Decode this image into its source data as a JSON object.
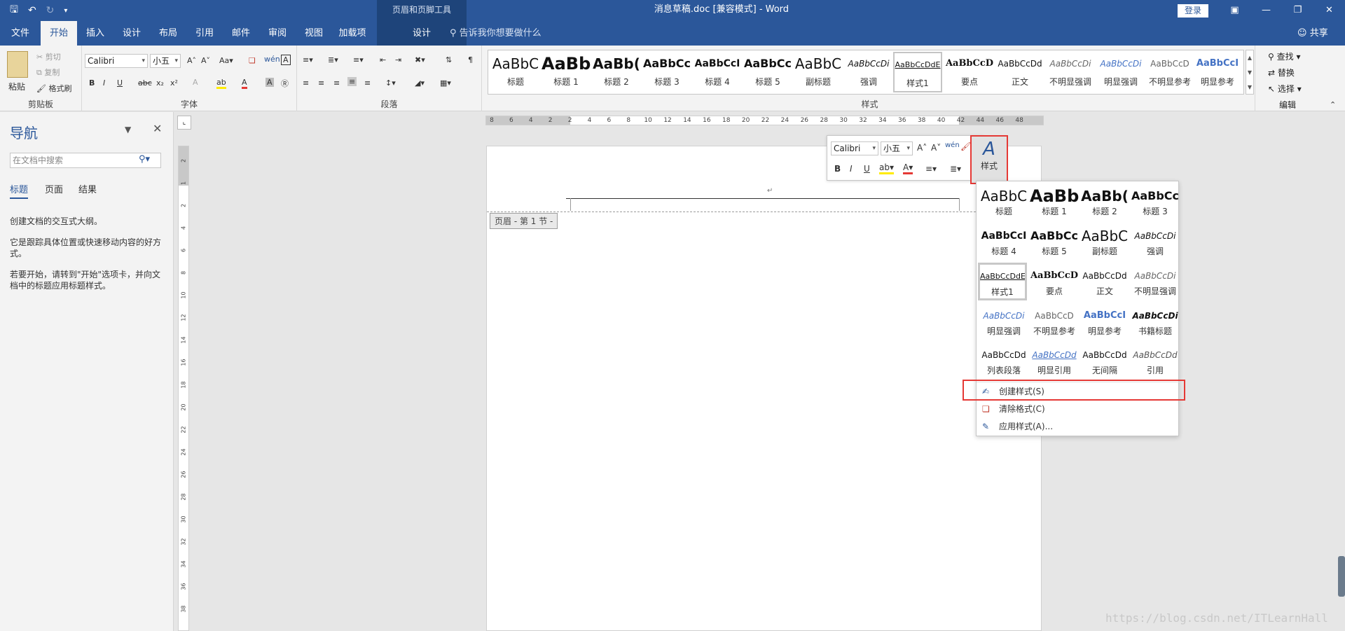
{
  "window": {
    "title": "消息草稿.doc [兼容模式]  -  Word",
    "context_tool_group": "页眉和页脚工具",
    "login": "登录"
  },
  "tabs": [
    "文件",
    "开始",
    "插入",
    "设计",
    "布局",
    "引用",
    "邮件",
    "审阅",
    "视图",
    "加载项"
  ],
  "context_tab": "设计",
  "active_tab": "开始",
  "tell_me": "告诉我你想要做什么",
  "share": "共享",
  "clipboard": {
    "paste": "粘贴",
    "cut": "剪切",
    "copy": "复制",
    "format_painter": "格式刷",
    "label": "剪贴板"
  },
  "font": {
    "name": "Calibri",
    "size": "小五",
    "label": "字体",
    "bold": "B",
    "italic": "I",
    "underline": "U"
  },
  "paragraph": {
    "label": "段落"
  },
  "styles_group": {
    "label": "样式"
  },
  "ribbon_styles": [
    {
      "sample": "AaBbC",
      "name": "标题"
    },
    {
      "sample": "AaBb",
      "name": "标题 1"
    },
    {
      "sample": "AaBb(",
      "name": "标题 2"
    },
    {
      "sample": "AaBbCc",
      "name": "标题 3"
    },
    {
      "sample": "AaBbCcI",
      "name": "标题 4"
    },
    {
      "sample": "AaBbCc",
      "name": "标题 5"
    },
    {
      "sample": "AaBbC",
      "name": "副标题"
    },
    {
      "sample": "AaBbCcDi",
      "name": "强调"
    },
    {
      "sample": "AaBbCcDdE",
      "name": "样式1"
    },
    {
      "sample": "AaBbCcD",
      "name": "要点"
    },
    {
      "sample": "AaBbCcDd",
      "name": "正文"
    },
    {
      "sample": "AaBbCcDi",
      "name": "不明显强调"
    },
    {
      "sample": "AaBbCcDi",
      "name": "明显强调"
    },
    {
      "sample": "AaBbCcD",
      "name": "不明显参考"
    },
    {
      "sample": "AaBbCcI",
      "name": "明显参考"
    }
  ],
  "editing": {
    "find": "查找",
    "replace": "替换",
    "select": "选择",
    "label": "编辑"
  },
  "nav": {
    "title": "导航",
    "search_placeholder": "在文档中搜索",
    "tabs": [
      "标题",
      "页面",
      "结果"
    ],
    "text1": "创建文档的交互式大纲。",
    "text2": "它是跟踪具体位置或快速移动内容的好方式。",
    "text3": "若要开始，请转到\"开始\"选项卡，并向文档中的标题应用标题样式。"
  },
  "ruler_ticks": [
    "8",
    "6",
    "4",
    "2",
    "2",
    "4",
    "6",
    "8",
    "10",
    "12",
    "14",
    "16",
    "18",
    "20",
    "22",
    "24",
    "26",
    "28",
    "30",
    "32",
    "34",
    "36",
    "38",
    "40",
    "42",
    "44",
    "46",
    "48"
  ],
  "vruler_ticks": [
    "2",
    "1",
    "2",
    "4",
    "6",
    "8",
    "10",
    "12",
    "14",
    "16",
    "18",
    "20",
    "22",
    "24",
    "26",
    "28",
    "30",
    "32",
    "34",
    "36",
    "38"
  ],
  "document": {
    "header_label": "页眉 - 第 1 节 -",
    "para_mark": "↵"
  },
  "mini_toolbar": {
    "font": "Calibri",
    "size": "小五",
    "styles_label": "样式"
  },
  "dropdown_styles": [
    {
      "sample": "AaBbC",
      "name": "标题"
    },
    {
      "sample": "AaBb",
      "name": "标题 1"
    },
    {
      "sample": "AaBb(",
      "name": "标题 2"
    },
    {
      "sample": "AaBbCc",
      "name": "标题 3"
    },
    {
      "sample": "AaBbCcI",
      "name": "标题 4"
    },
    {
      "sample": "AaBbCc",
      "name": "标题 5"
    },
    {
      "sample": "AaBbC",
      "name": "副标题"
    },
    {
      "sample": "AaBbCcDi",
      "name": "强调"
    },
    {
      "sample": "AaBbCcDdE",
      "name": "样式1"
    },
    {
      "sample": "AaBbCcD",
      "name": "要点"
    },
    {
      "sample": "AaBbCcDd",
      "name": "正文"
    },
    {
      "sample": "AaBbCcDi",
      "name": "不明显强调"
    },
    {
      "sample": "AaBbCcDi",
      "name": "明显强调"
    },
    {
      "sample": "AaBbCcD",
      "name": "不明显参考"
    },
    {
      "sample": "AaBbCcI",
      "name": "明显参考"
    },
    {
      "sample": "AaBbCcDi",
      "name": "书籍标题"
    },
    {
      "sample": "AaBbCcDd",
      "name": "列表段落"
    },
    {
      "sample": "AaBbCcDd",
      "name": "明显引用"
    },
    {
      "sample": "AaBbCcDd",
      "name": "无间隔"
    },
    {
      "sample": "AaBbCcDd",
      "name": "引用"
    }
  ],
  "dropdown_menu": {
    "create": "创建样式(S)",
    "clear": "清除格式(C)",
    "apply": "应用样式(A)..."
  },
  "watermark": "https://blog.csdn.net/ITLearnHall",
  "colors": {
    "brand": "#2b579a",
    "highlight_box": "#e53935"
  }
}
